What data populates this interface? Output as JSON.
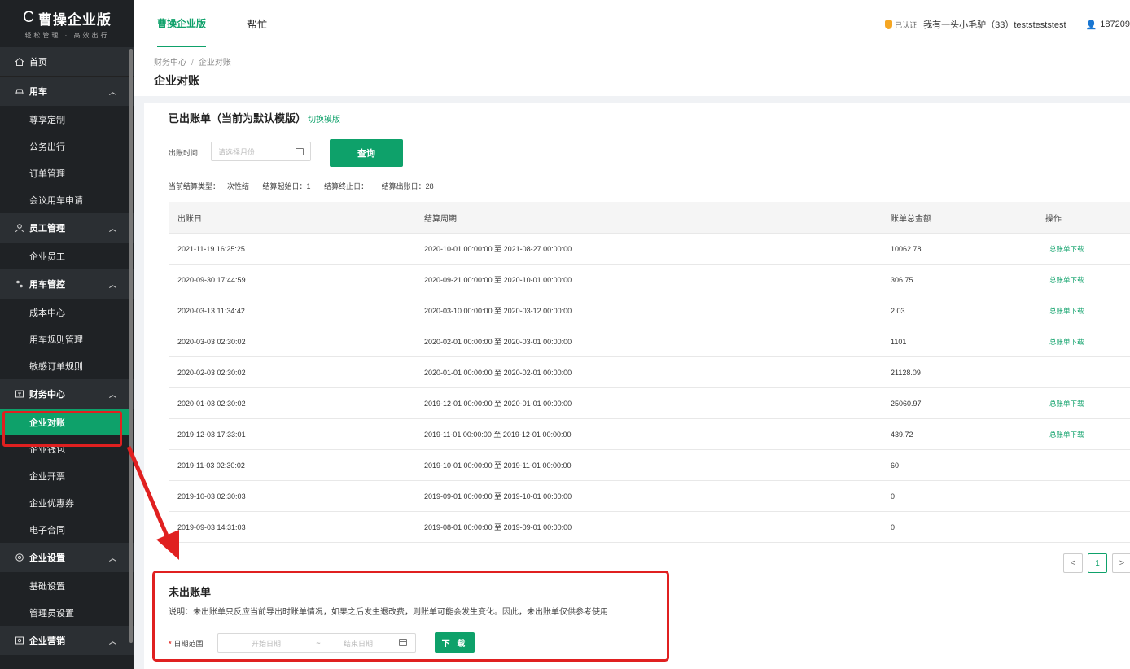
{
  "brand": {
    "name": "曹操企业版",
    "letter": "C",
    "slogan": "轻松管理 · 高效出行"
  },
  "header": {
    "tabs": [
      {
        "label": "曹操企业版",
        "active": true
      },
      {
        "label": "帮忙",
        "active": false
      }
    ],
    "cert_label": "已认证",
    "company": "我有一头小毛驴（33）teststeststest",
    "user_phone": "187209"
  },
  "sidebar": {
    "home": "首页",
    "groups": [
      {
        "label": "用车",
        "icon": "car-icon",
        "items": [
          "尊享定制",
          "公务出行",
          "订单管理",
          "会议用车申请"
        ]
      },
      {
        "label": "员工管理",
        "icon": "user-icon",
        "items": [
          "企业员工"
        ]
      },
      {
        "label": "用车管控",
        "icon": "sliders-icon",
        "items": [
          "成本中心",
          "用车规则管理",
          "敏感订单规则"
        ]
      },
      {
        "label": "财务中心",
        "icon": "finance-icon",
        "items": [
          "企业对账",
          "企业钱包",
          "企业开票",
          "企业优惠券",
          "电子合同"
        ]
      },
      {
        "label": "企业设置",
        "icon": "settings-icon",
        "items": [
          "基础设置",
          "管理员设置"
        ]
      },
      {
        "label": "企业营销",
        "icon": "marketing-icon",
        "items": []
      }
    ],
    "active_item": "企业对账"
  },
  "breadcrumb": {
    "parent": "财务中心",
    "separator": "/",
    "current": "企业对账"
  },
  "page_title": "企业对账",
  "billed": {
    "title": "已出账单（当前为默认模版）",
    "switch_link": "切换模版",
    "filter_label": "出账时间",
    "month_placeholder": "请选择月份",
    "query_button": "查询",
    "info": {
      "settle_type": "当前结算类型：一次性结",
      "start_day": "结算起始日：1",
      "end_day": "结算终止日：",
      "bill_day": "结算出账日：28"
    },
    "columns": [
      "出账日",
      "结算周期",
      "账单总金额",
      "操作"
    ],
    "download_label": "总账单下载",
    "rows": [
      {
        "date": "2021-11-19 16:25:25",
        "period": "2020-10-01 00:00:00 至 2021-08-27 00:00:00",
        "amount": "10062.78",
        "action": "总账单下载"
      },
      {
        "date": "2020-09-30 17:44:59",
        "period": "2020-09-21 00:00:00 至 2020-10-01 00:00:00",
        "amount": "306.75",
        "action": "总账单下载"
      },
      {
        "date": "2020-03-13 11:34:42",
        "period": "2020-03-10 00:00:00 至 2020-03-12 00:00:00",
        "amount": "2.03",
        "action": "总账单下载"
      },
      {
        "date": "2020-03-03 02:30:02",
        "period": "2020-02-01 00:00:00 至 2020-03-01 00:00:00",
        "amount": "1101",
        "action": "总账单下载"
      },
      {
        "date": "2020-02-03 02:30:02",
        "period": "2020-01-01 00:00:00 至 2020-02-01 00:00:00",
        "amount": "21128.09",
        "action": ""
      },
      {
        "date": "2020-01-03 02:30:02",
        "period": "2019-12-01 00:00:00 至 2020-01-01 00:00:00",
        "amount": "25060.97",
        "action": "总账单下载"
      },
      {
        "date": "2019-12-03 17:33:01",
        "period": "2019-11-01 00:00:00 至 2019-12-01 00:00:00",
        "amount": "439.72",
        "action": "总账单下载"
      },
      {
        "date": "2019-11-03 02:30:02",
        "period": "2019-10-01 00:00:00 至 2019-11-01 00:00:00",
        "amount": "60",
        "action": ""
      },
      {
        "date": "2019-10-03 02:30:03",
        "period": "2019-09-01 00:00:00 至 2019-10-01 00:00:00",
        "amount": "0",
        "action": ""
      },
      {
        "date": "2019-09-03 14:31:03",
        "period": "2019-08-01 00:00:00 至 2019-09-01 00:00:00",
        "amount": "0",
        "action": ""
      }
    ],
    "pagination": {
      "prev": "<",
      "current": "1",
      "next": ">"
    }
  },
  "unbilled": {
    "title": "未出账单",
    "description": "说明：未出账单只反应当前导出时账单情况，如果之后发生退改费，则账单可能会发生变化。因此，未出账单仅供参考使用",
    "required_mark": "*",
    "range_label": "日期范围",
    "start_placeholder": "开始日期",
    "range_sep": "~",
    "end_placeholder": "结束日期",
    "download_button": "下 载"
  },
  "colors": {
    "accent": "#0ea16a",
    "sidebar_bg": "#1f2225",
    "annotation": "#e02020"
  }
}
